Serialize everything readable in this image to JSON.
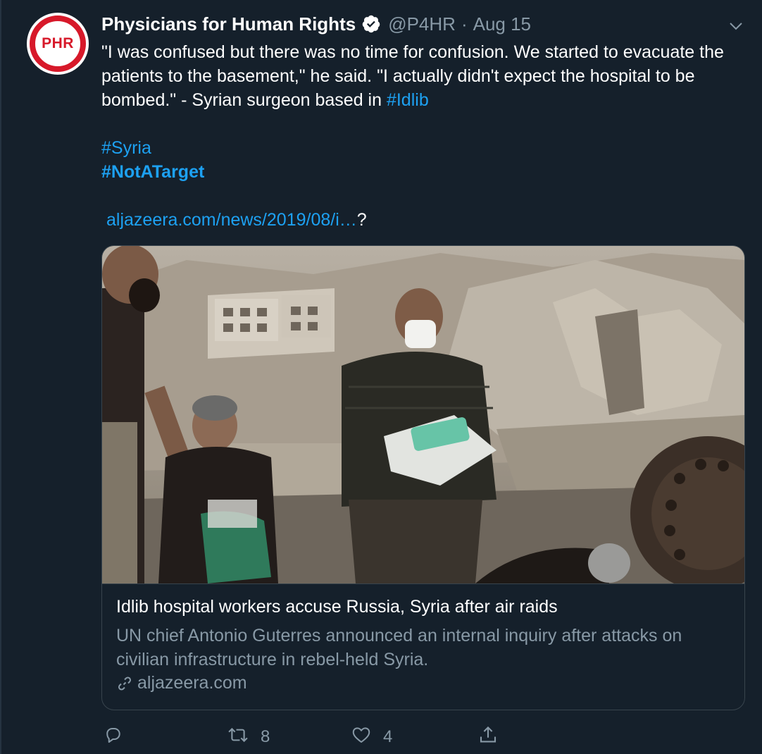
{
  "tweet": {
    "avatar_text": "PHR",
    "display_name": "Physicians for Human Rights",
    "handle": "@P4HR",
    "separator": "·",
    "date": "Aug 15",
    "text_part1": "\"I was confused but there was no time for confusion. We started to evacuate the patients to the basement,\" he said. \"I actually didn't expect the hospital to be bombed.\" - Syrian surgeon based in ",
    "hashtag_idlib": "#Idlib",
    "hashtag_syria": "#Syria",
    "hashtag_notatarget": "#NotATarget",
    "url_text": "aljazeera.com/news/2019/08/i…",
    "url_suffix": "?"
  },
  "card": {
    "title": "Idlib hospital workers accuse Russia, Syria after air raids",
    "description": "UN chief Antonio Guterres announced an internal inquiry after attacks on civilian infrastructure in rebel-held Syria.",
    "domain": "aljazeera.com"
  },
  "actions": {
    "reply_count": "",
    "retweet_count": "8",
    "like_count": "4"
  },
  "colors": {
    "background": "#15202b",
    "link": "#1da1f2",
    "muted": "#8899a6",
    "border": "#38444d",
    "brand_red": "#d7192a"
  },
  "icons": [
    "verified-badge-icon",
    "chevron-down-icon",
    "link-icon",
    "reply-icon",
    "retweet-icon",
    "like-icon",
    "share-icon"
  ]
}
